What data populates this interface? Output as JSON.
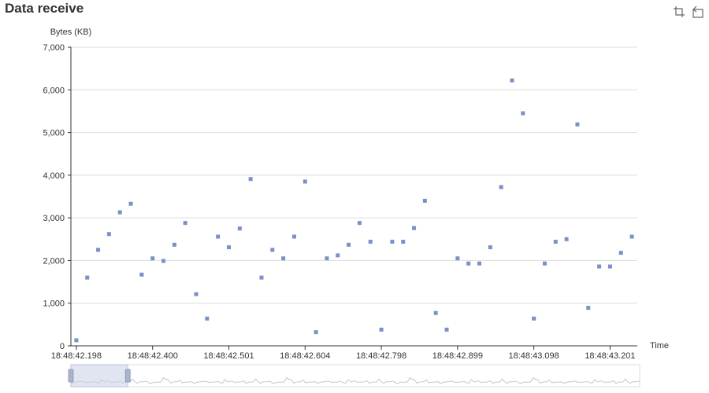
{
  "title": "Data receive",
  "toolbox": {
    "zoom_icon": "data-zoom-icon",
    "reset_icon": "zoom-reset-icon"
  },
  "colors": {
    "point": "#7b8fca",
    "axis": "#333333",
    "grid": "#dddddd",
    "slider_fill": "#c7d0e6",
    "slider_border": "#bbc3d6",
    "handle": "#aab4cf",
    "mini_line": "#c7c7c7"
  },
  "chart_data": {
    "type": "scatter",
    "title": "Data receive",
    "xlabel": "Time",
    "ylabel": "Bytes (KB)",
    "ylim": [
      0,
      7000
    ],
    "yticks": [
      "0",
      "1,000",
      "2,000",
      "3,000",
      "4,000",
      "5,000",
      "6,000",
      "7,000"
    ],
    "xticks": [
      "18:48:42.198",
      "18:48:42.400",
      "18:48:42.501",
      "18:48:42.604",
      "18:48:42.798",
      "18:48:42.899",
      "18:48:43.098",
      "18:48:43.201"
    ],
    "grid": true,
    "values": [
      130,
      1600,
      2250,
      2620,
      3130,
      3330,
      1670,
      2050,
      1990,
      2370,
      2880,
      1210,
      640,
      2560,
      2310,
      2750,
      3910,
      1600,
      2250,
      2050,
      2560,
      3850,
      320,
      2050,
      2120,
      2370,
      2880,
      2440,
      380,
      2440,
      2440,
      2760,
      3400,
      770,
      380,
      2050,
      1930,
      1930,
      2310,
      3720,
      6220,
      5450,
      640,
      1930,
      2440,
      2500,
      5190,
      890,
      1860,
      1860,
      2180,
      2560
    ],
    "dataZoom": {
      "start_fraction": 0.0,
      "end_fraction": 0.1
    }
  }
}
